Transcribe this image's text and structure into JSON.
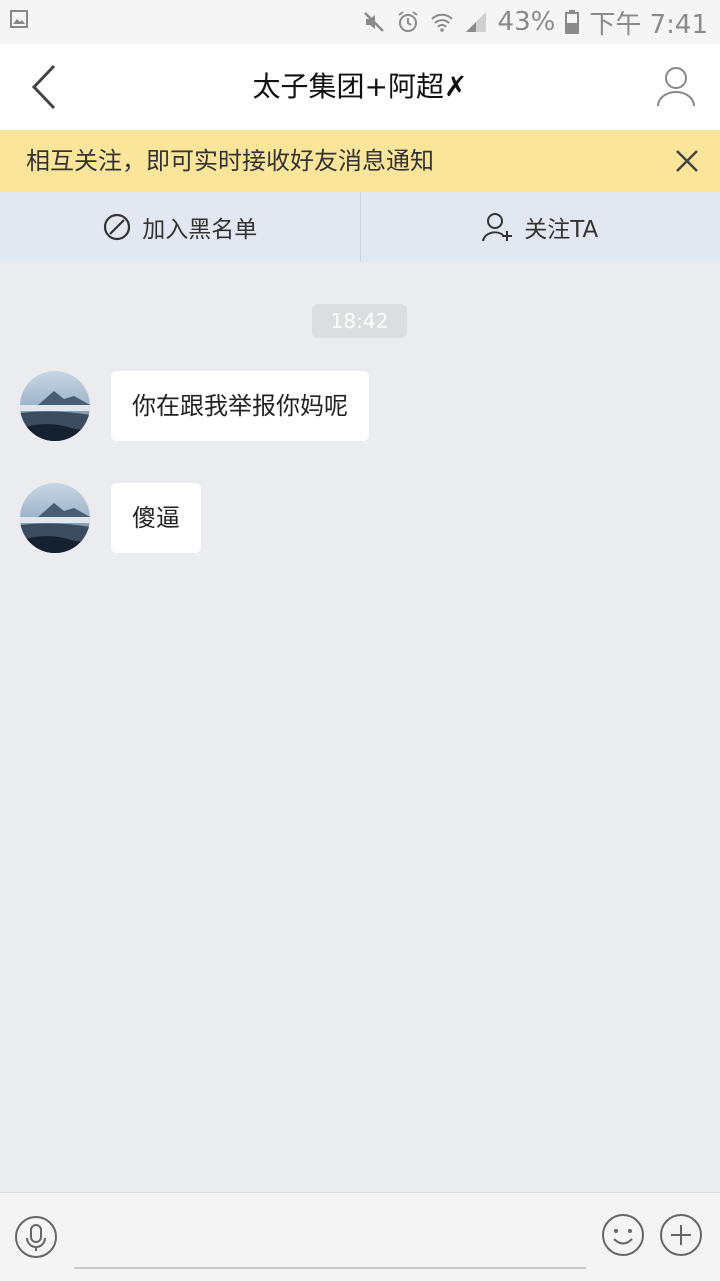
{
  "status_bar": {
    "battery": "43%",
    "time": "下午 7:41",
    "icons": [
      "image-icon",
      "mute-icon",
      "alarm-icon",
      "wifi-icon",
      "signal-icon",
      "battery-icon"
    ]
  },
  "header": {
    "title": "太子集团+阿超✗",
    "back_icon": "chevron-left-icon",
    "profile_icon": "user-icon"
  },
  "notice": {
    "text": "相互关注，即可实时接收好友消息通知",
    "close_icon": "close-icon"
  },
  "actions": {
    "block_label": "加入黑名单",
    "follow_label": "关注TA"
  },
  "chat": {
    "timestamp": "18:42",
    "messages": [
      {
        "text": "你在跟我举报你妈呢"
      },
      {
        "text": "傻逼"
      }
    ]
  },
  "input_bar": {
    "placeholder": "",
    "icons": [
      "microphone-icon",
      "emoji-icon",
      "plus-icon"
    ]
  },
  "colors": {
    "notice_bg": "#fbe59a",
    "chat_bg": "#ebecf0",
    "action_bg": "#e3e7f1"
  }
}
